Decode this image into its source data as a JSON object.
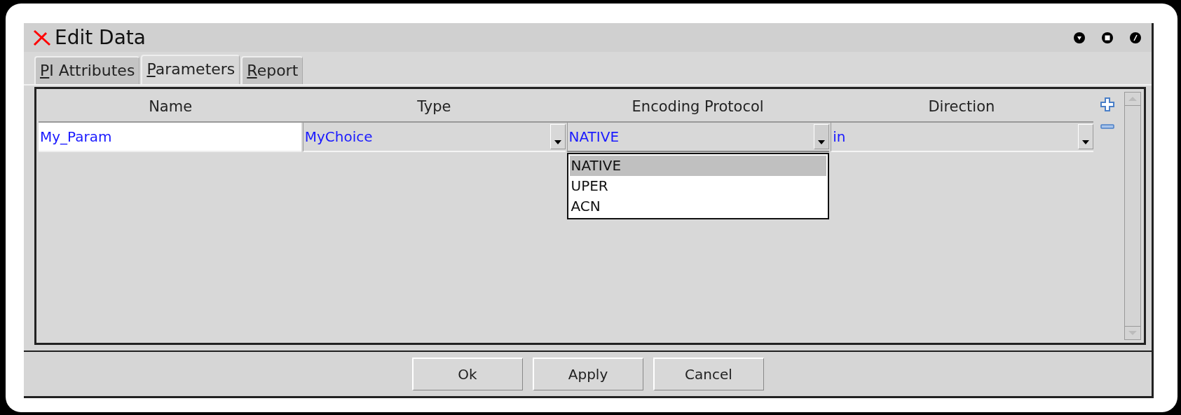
{
  "window": {
    "title": "Edit Data"
  },
  "tabs": [
    {
      "label": "PI Attributes",
      "selected": false
    },
    {
      "label": "Parameters",
      "selected": true
    },
    {
      "label": "Report",
      "selected": false
    }
  ],
  "table": {
    "columns": [
      "Name",
      "Type",
      "Encoding Protocol",
      "Direction"
    ],
    "rows": [
      {
        "cells": [
          {
            "kind": "text",
            "value": "My_Param"
          },
          {
            "kind": "combo",
            "value": "MyChoice"
          },
          {
            "kind": "combo",
            "value": "NATIVE",
            "expanded": true,
            "options": [
              {
                "label": "NATIVE",
                "selected": true
              },
              {
                "label": "UPER",
                "selected": false
              },
              {
                "label": "ACN",
                "selected": false
              }
            ]
          },
          {
            "kind": "combo",
            "value": "in"
          }
        ]
      }
    ]
  },
  "buttons": [
    "Ok",
    "Apply",
    "Cancel"
  ]
}
